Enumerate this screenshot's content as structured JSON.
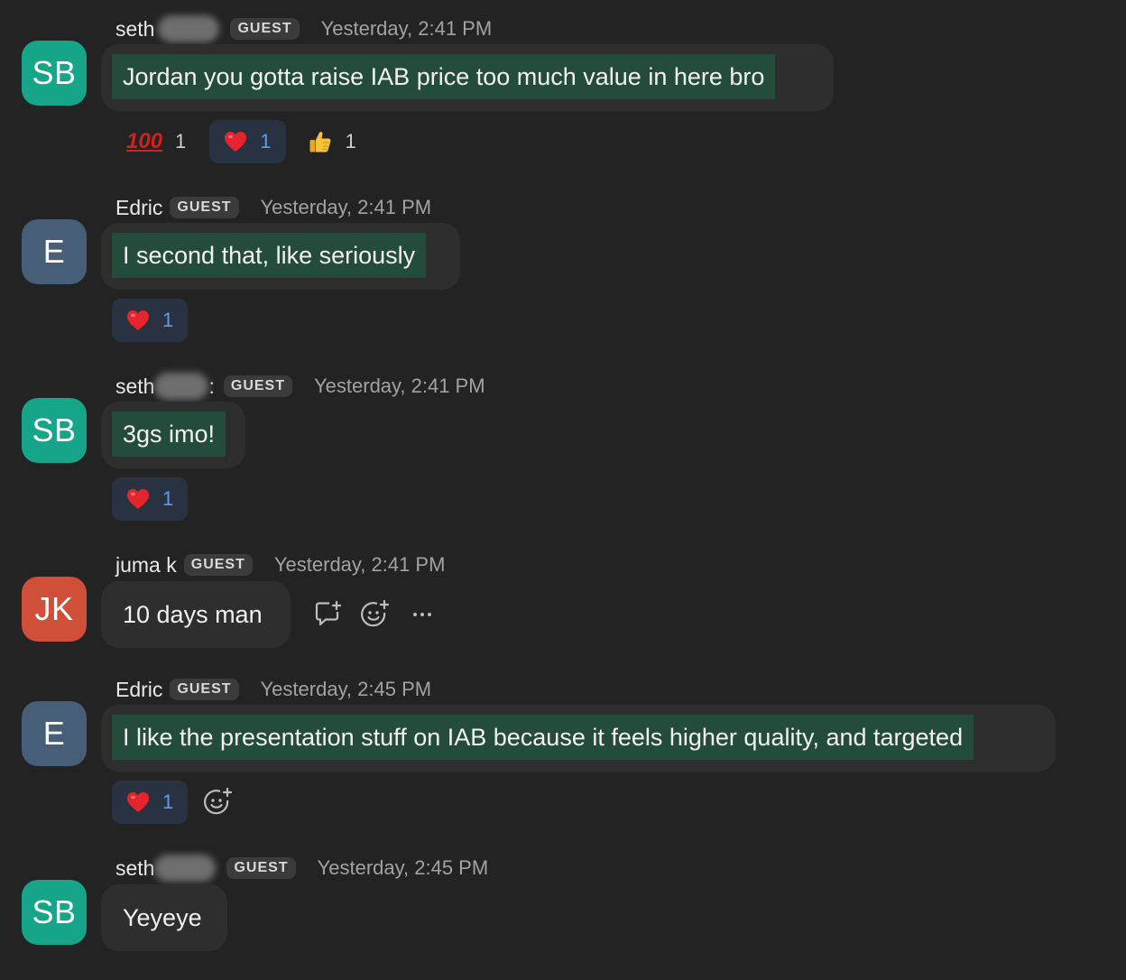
{
  "messages": [
    {
      "initials": "SB",
      "sender": "seth",
      "badge": "GUEST",
      "time": "Yesterday, 2:41 PM",
      "text": "Jordan you gotta raise IAB price too much value in here bro",
      "reactions": [
        {
          "emoji": "💯",
          "count": "1",
          "active": false
        },
        {
          "emoji": "❤️",
          "count": "1",
          "active": true
        },
        {
          "emoji": "👍",
          "count": "1",
          "active": false
        }
      ]
    },
    {
      "initials": "E",
      "sender": "Edric",
      "badge": "GUEST",
      "time": "Yesterday, 2:41 PM",
      "text": "I second that, like seriously",
      "reactions": [
        {
          "emoji": "❤️",
          "count": "1",
          "active": true
        }
      ]
    },
    {
      "initials": "SB",
      "sender": "seth",
      "sender_suffix": ":",
      "badge": "GUEST",
      "time": "Yesterday, 2:41 PM",
      "text": "3gs imo!",
      "reactions": [
        {
          "emoji": "❤️",
          "count": "1",
          "active": true
        }
      ]
    },
    {
      "initials": "JK",
      "sender": "juma k",
      "badge": "GUEST",
      "time": "Yesterday, 2:41 PM",
      "text": "10 days man",
      "hover_actions": [
        "reply-in-thread-icon",
        "add-reaction-icon",
        "more-options-icon"
      ]
    },
    {
      "initials": "E",
      "sender": "Edric",
      "badge": "GUEST",
      "time": "Yesterday, 2:45 PM",
      "text": "I like the presentation stuff on IAB because it feels higher quality, and targeted",
      "reactions": [
        {
          "emoji": "❤️",
          "count": "1",
          "active": true
        }
      ],
      "add_reaction": "add-reaction-icon"
    },
    {
      "initials": "SB",
      "sender": "seth",
      "badge": "GUEST",
      "time": "Yesterday, 2:45 PM",
      "text": "Yeyeye"
    }
  ],
  "colors": {
    "background": "#232323",
    "bubble": "#2e2e2e",
    "highlight": "#244c3a",
    "avatar_teal": "#17a589",
    "avatar_slate": "#465e78",
    "avatar_red": "#cf4f38",
    "reaction_active": "#283240",
    "reaction_count_active": "#5c9bf0"
  }
}
